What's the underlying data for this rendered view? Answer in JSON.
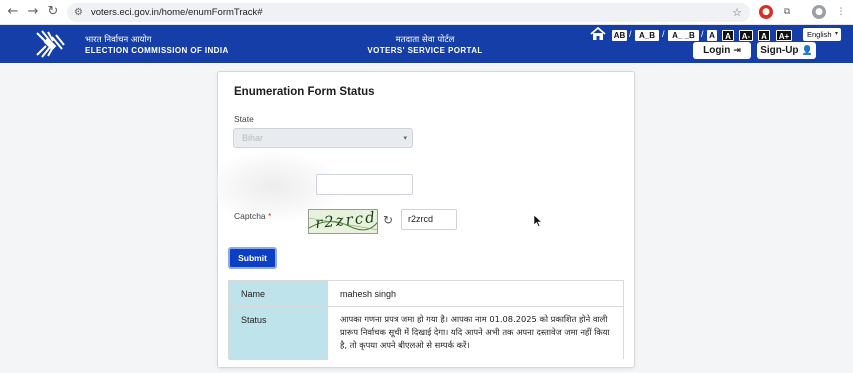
{
  "browser": {
    "url": "voters.eci.gov.in/home/enumFormTrack#",
    "back_icon": "back-arrow-icon",
    "forward_icon": "forward-arrow-icon",
    "reload_icon": "reload-icon"
  },
  "header": {
    "eci_hindi": "भारत निर्वाचन आयोग",
    "eci_english": "ELECTION COMMISSION OF INDIA",
    "portal_hindi": "मतदाता सेवा पोर्टल",
    "portal_english": "VOTERS' SERVICE PORTAL",
    "accessibility": [
      "AB",
      "A_B",
      "A_ _B",
      "A",
      "A",
      "A-",
      "A",
      "A+"
    ],
    "language": "English",
    "login_label": "Login",
    "signup_label": "Sign-Up",
    "background_color": "#163ea8"
  },
  "form": {
    "title": "Enumeration Form Status",
    "state_label": "State",
    "state_value": "Bihar",
    "captcha_label": "Captcha",
    "captcha_required_mark": "*",
    "captcha_image_text": "r2zrcd",
    "captcha_input_value": "r2zrcd",
    "submit_label": "Submit",
    "submit_color": "#0d3fc4"
  },
  "result": {
    "name_label": "Name",
    "name_value": "mahesh singh",
    "status_label": "Status",
    "status_value": "आपका गणना प्रपत्र जमा हो गया है। आपका नाम 01.08.2025 को प्रकाशित होने वाली प्रारूप निर्वाचक सूची में दिखाई देगा। यदि आपने अभी तक अपना दस्तावेज जमा नहीं किया है, तो कृपया अपने बीएलओ से सम्पर्क करें।",
    "label_bg_color": "#bfe3ea"
  }
}
